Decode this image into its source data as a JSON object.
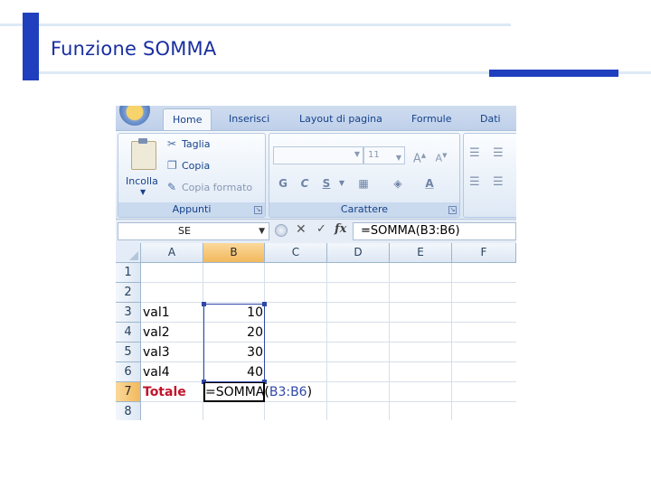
{
  "slide": {
    "title": "Funzione SOMMA"
  },
  "ribbon": {
    "tabs": [
      "Home",
      "Inserisci",
      "Layout di pagina",
      "Formule",
      "Dati"
    ],
    "active_tab": "Home",
    "clipboard": {
      "paste_label": "Incolla",
      "cut_label": "Taglia",
      "copy_label": "Copia",
      "format_painter_label": "Copia formato",
      "group_label": "Appunti"
    },
    "font": {
      "size": "11",
      "bold": "G",
      "italic": "C",
      "underline": "S",
      "grow": "A",
      "shrink": "A",
      "color_letter": "A",
      "group_label": "Carattere"
    }
  },
  "formula_bar": {
    "name_box": "SE",
    "formula": "=SOMMA(B3:B6)"
  },
  "sheet": {
    "columns": [
      "A",
      "B",
      "C",
      "D",
      "E",
      "F"
    ],
    "rows": [
      "1",
      "2",
      "3",
      "4",
      "5",
      "6",
      "7",
      "8"
    ],
    "cells": {
      "A3": "val1",
      "B3": "10",
      "A4": "val2",
      "B4": "20",
      "A5": "val3",
      "B5": "30",
      "A6": "val4",
      "B6": "40",
      "A7": "Totale"
    },
    "edit_cell": {
      "prefix": "=SOMMA(",
      "range_ref": "B3:B6",
      "suffix": ")"
    }
  },
  "colors": {
    "accent_blue": "#1f3fbf",
    "title_blue": "#1a2fa0",
    "total_red": "#c0152c",
    "range_blue": "#2f48a8",
    "selection_orange": "#f2b85c"
  }
}
